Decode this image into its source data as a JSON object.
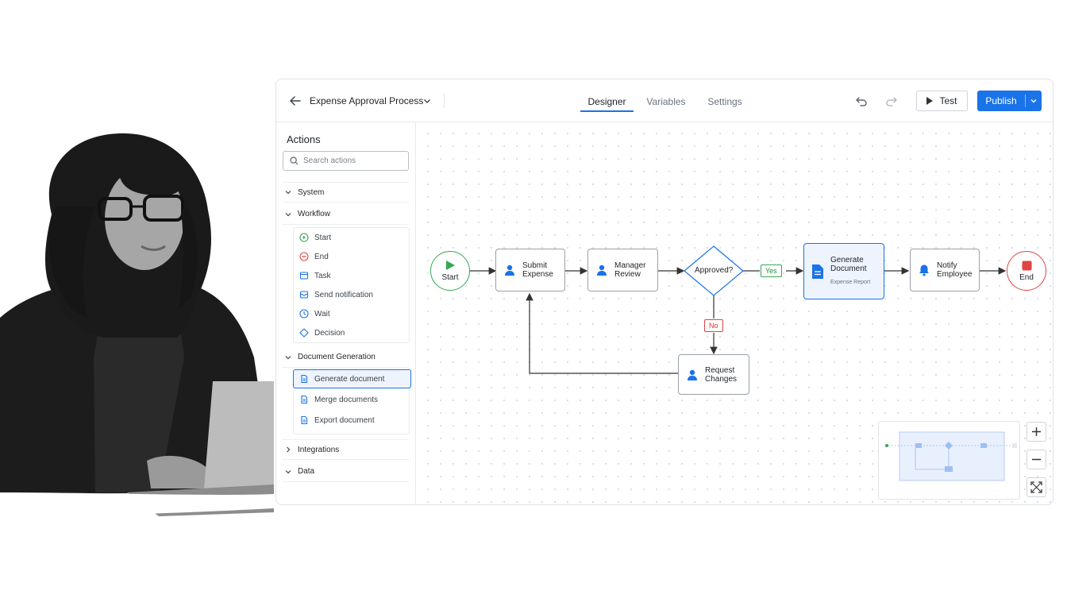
{
  "header": {
    "process_name": "Expense Approval Process",
    "tabs": [
      {
        "label": "Designer",
        "active": true
      },
      {
        "label": "Variables",
        "active": false
      },
      {
        "label": "Settings",
        "active": false
      }
    ],
    "test_label": "Test",
    "publish_label": "Publish"
  },
  "sidebar": {
    "title": "Actions",
    "search_placeholder": "Search actions",
    "groups": [
      {
        "label": "System",
        "expanded": true,
        "items": []
      },
      {
        "label": "Workflow",
        "expanded": true,
        "items": [
          {
            "label": "Start",
            "icon": "play-circle-icon"
          },
          {
            "label": "End",
            "icon": "stop-circle-icon"
          },
          {
            "label": "Task",
            "icon": "task-icon"
          },
          {
            "label": "Send notification",
            "icon": "notification-icon"
          },
          {
            "label": "Wait",
            "icon": "clock-icon"
          },
          {
            "label": "Decision",
            "icon": "decision-icon"
          }
        ]
      },
      {
        "label": "Document Generation",
        "expanded": true,
        "items": [
          {
            "label": "Generate document",
            "icon": "document-icon",
            "selected": true
          },
          {
            "label": "Merge documents",
            "icon": "document-icon"
          },
          {
            "label": "Export document",
            "icon": "document-icon"
          }
        ]
      },
      {
        "label": "Integrations",
        "expanded": false,
        "items": []
      },
      {
        "label": "Data",
        "expanded": true,
        "items": []
      }
    ]
  },
  "flow": {
    "start": "Start",
    "submit": [
      "Submit",
      "Expense"
    ],
    "review": [
      "Manager",
      "Review"
    ],
    "decision": "Approved?",
    "yes": "Yes",
    "no": "No",
    "generate": [
      "Generate",
      "Document"
    ],
    "generate_sub": "Expense Report",
    "notify": [
      "Notify",
      "Employee"
    ],
    "request": [
      "Request",
      "Changes"
    ],
    "end": "End"
  },
  "colors": {
    "accent": "#1a73e8",
    "start": "#34a853",
    "end": "#e04444",
    "person": "#1a73e8"
  }
}
